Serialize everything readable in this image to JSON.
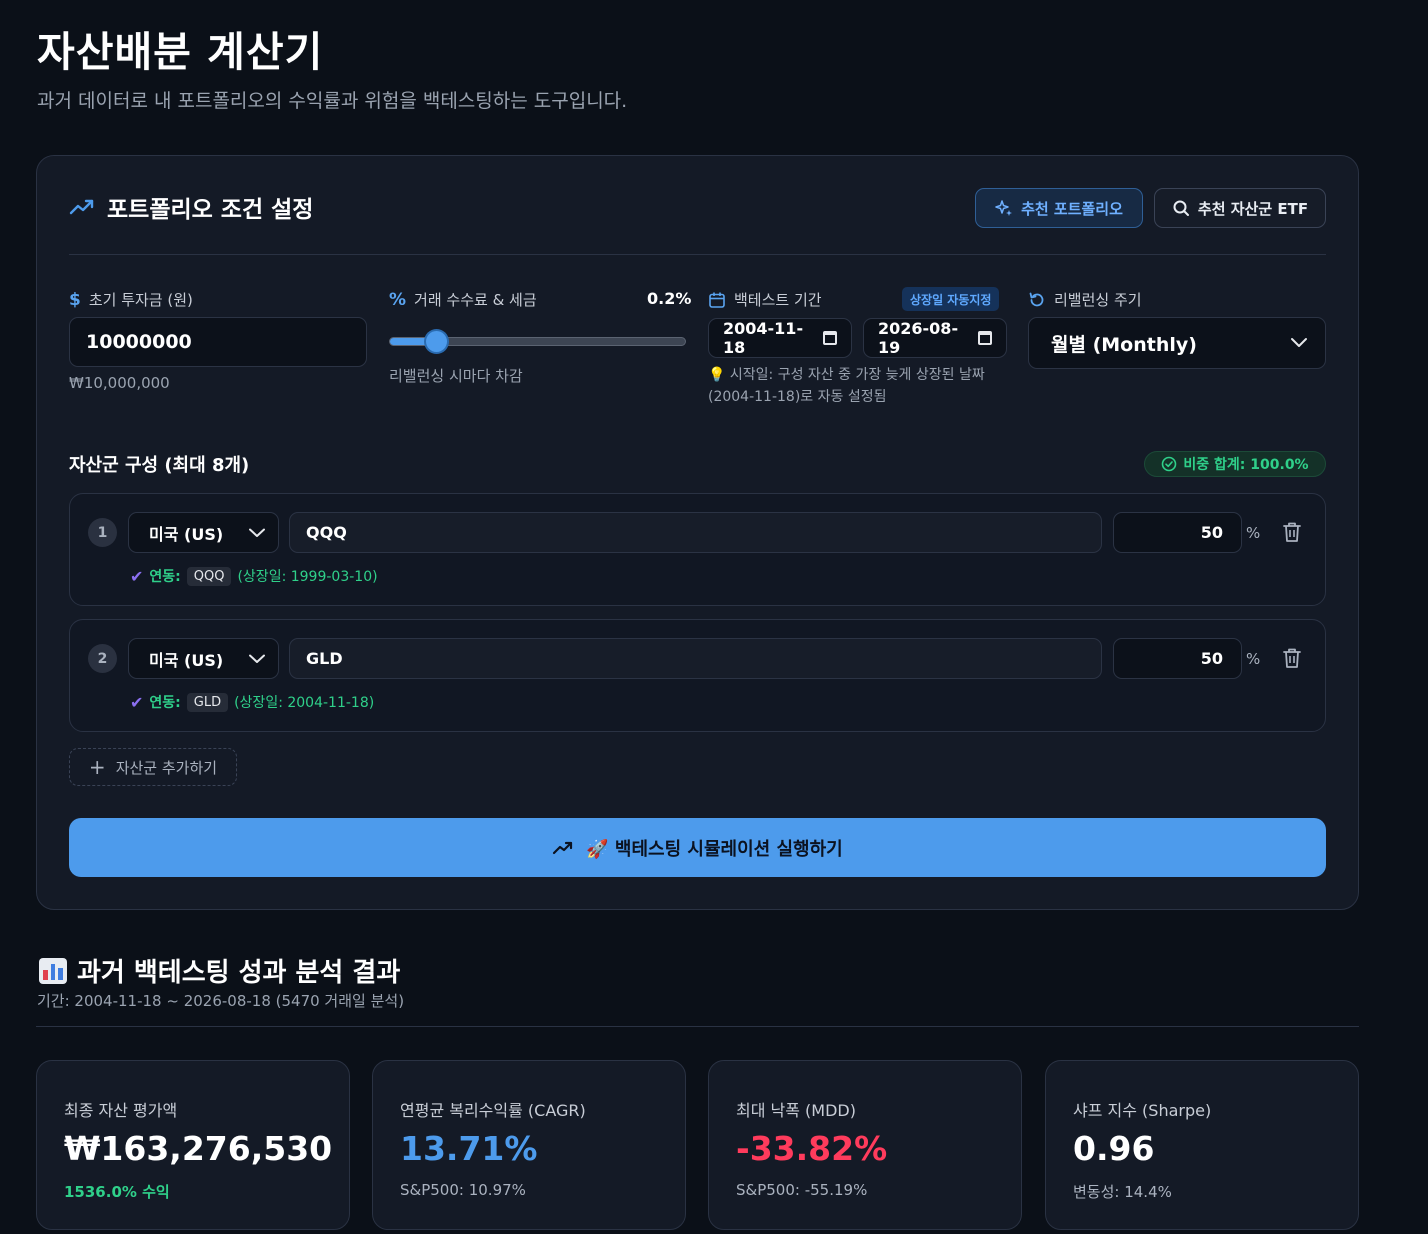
{
  "page": {
    "title": "자산배분 계산기",
    "subtitle": "과거 데이터로 내 포트폴리오의 수익률과 위험을 백테스팅하는 도구입니다."
  },
  "settings": {
    "title": "포트폴리오 조건 설정",
    "recommend_portfolio_label": "추천 포트폴리오",
    "recommend_etf_label": "추천 자산군 ETF",
    "initial_investment": {
      "label": "초기 투자금 (원)",
      "value": "10000000",
      "formatted": "₩10,000,000"
    },
    "fee": {
      "label": "거래 수수료 & 세금",
      "value_label": "0.2%",
      "fraction": 0.155,
      "hint": "리밸런싱 시마다 차감"
    },
    "period": {
      "label": "백테스트 기간",
      "auto_badge": "상장일 자동지정",
      "start": "2004-11-18",
      "end": "2026-08-19",
      "note": "💡 시작일: 구성 자산 중 가장 늦게 상장된 날짜 (2004-11-18)로 자동 설정됨"
    },
    "rebalance": {
      "label": "리밸런싱 주기",
      "value": "월별 (Monthly)"
    }
  },
  "assets": {
    "title": "자산군 구성 (최대 8개)",
    "weight_total": "비중 합계: 100.0%",
    "pct_symbol": "%",
    "linked_label": "연동:",
    "rows": [
      {
        "index": "1",
        "market": "미국 (US)",
        "ticker": "QQQ",
        "weight": "50",
        "chip": "QQQ",
        "listed": "(상장일: 1999-03-10)"
      },
      {
        "index": "2",
        "market": "미국 (US)",
        "ticker": "GLD",
        "weight": "50",
        "chip": "GLD",
        "listed": "(상장일: 2004-11-18)"
      }
    ],
    "add_label": "자산군 추가하기"
  },
  "run_button": "🚀 백테스팅 시뮬레이션 실행하기",
  "results": {
    "title": "과거 백테스팅 성과 분석 결과",
    "period": "기간: 2004-11-18 ~ 2026-08-18 (5470 거래일 분석)",
    "metrics": [
      {
        "label": "최종 자산 평가액",
        "value": "₩163,276,530",
        "sub": "1536.0% 수익",
        "value_color": "#ffffff",
        "sub_color": "#2fd08a"
      },
      {
        "label": "연평균 복리수익률 (CAGR)",
        "value": "13.71%",
        "sub": "S&P500: 10.97%",
        "value_color": "#4d9bec",
        "sub_color": "#aab2bf"
      },
      {
        "label": "최대 낙폭 (MDD)",
        "value": "-33.82%",
        "sub": "S&P500: -55.19%",
        "value_color": "#ff3b5c",
        "sub_color": "#aab2bf"
      },
      {
        "label": "샤프 지수 (Sharpe)",
        "value": "0.96",
        "sub": "변동성: 14.4%",
        "value_color": "#ffffff",
        "sub_color": "#aab2bf"
      }
    ]
  },
  "colors": {
    "accent": "#4d9bec",
    "success": "#2fd08a",
    "danger": "#ff3b5c",
    "background": "#0b1018",
    "card": "#141a26"
  }
}
